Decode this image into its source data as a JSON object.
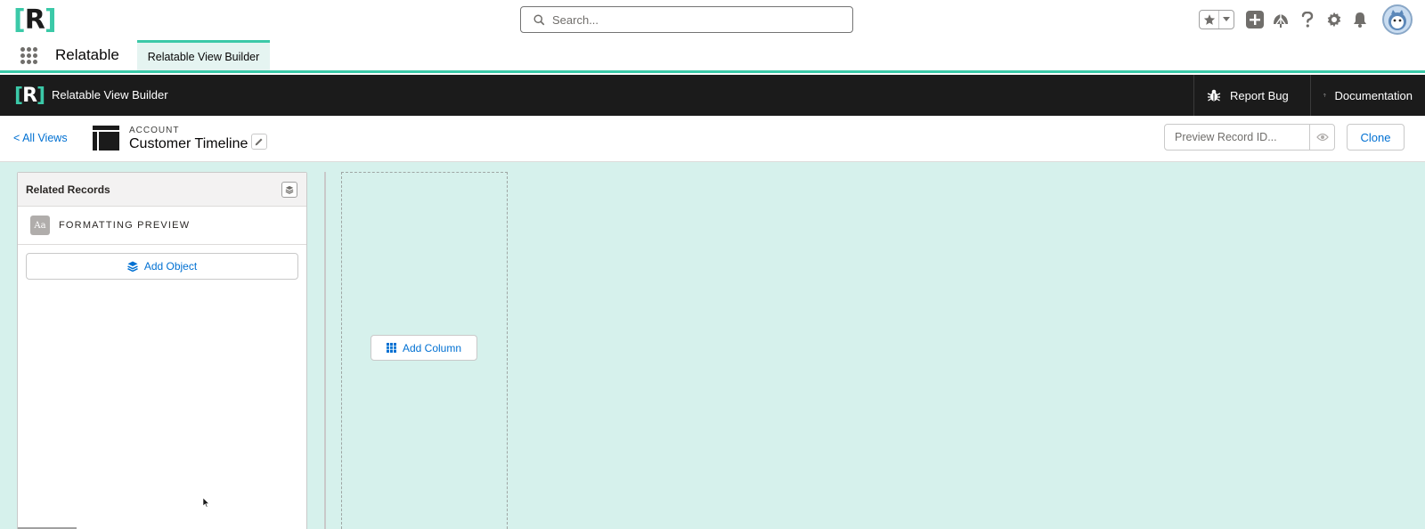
{
  "global_header": {
    "logo_text": "[R]",
    "search_placeholder": "Search...",
    "icons": [
      "star-icon",
      "chevron-down-icon",
      "plus-icon",
      "trailhead-icon",
      "help-icon",
      "gear-icon",
      "bell-icon",
      "avatar"
    ]
  },
  "app_nav": {
    "app_name": "Relatable",
    "tabs": [
      {
        "label": "Relatable View Builder",
        "active": true
      }
    ]
  },
  "app_bar": {
    "logo_text": "[R]",
    "title": "Relatable View Builder",
    "report_bug_label": "Report Bug",
    "documentation_label": "Documentation"
  },
  "page_header": {
    "back_link": "< All Views",
    "record_type": "ACCOUNT",
    "record_name": "Customer Timeline",
    "preview_placeholder": "Preview Record ID...",
    "clone_label": "Clone"
  },
  "side_panel": {
    "title": "Related Records",
    "objects": [
      {
        "label": "FORMATTING PREVIEW",
        "icon_text": "Aa"
      }
    ],
    "add_object_label": "Add Object"
  },
  "column_zone": {
    "add_column_label": "Add Column"
  },
  "colors": {
    "brand_teal": "#3bc9a8",
    "canvas_bg": "#d6f1ec",
    "dark_bar": "#1b1b1b",
    "link_blue": "#0070d2"
  }
}
